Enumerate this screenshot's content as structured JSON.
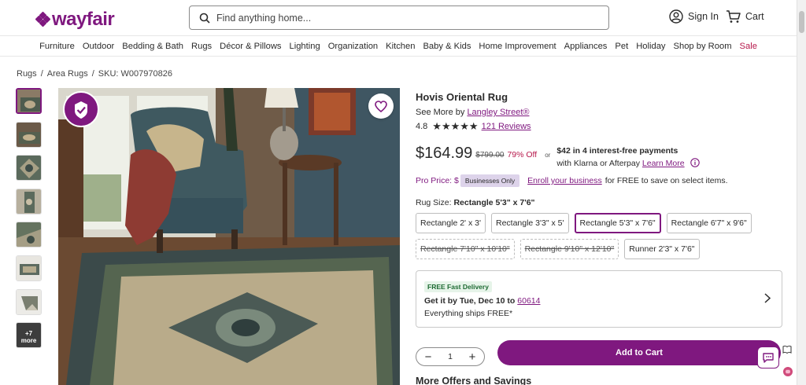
{
  "header": {
    "logo_text": "wayfair",
    "search_placeholder": "Find anything home...",
    "signin_label": "Sign In",
    "cart_label": "Cart"
  },
  "nav": {
    "items": [
      "Furniture",
      "Outdoor",
      "Bedding & Bath",
      "Rugs",
      "Décor & Pillows",
      "Lighting",
      "Organization",
      "Kitchen",
      "Baby & Kids",
      "Home Improvement",
      "Appliances",
      "Pet",
      "Holiday",
      "Shop by Room",
      "Sale"
    ]
  },
  "breadcrumb": {
    "items": [
      "Rugs",
      "Area Rugs",
      "SKU: W007970826"
    ],
    "separator": "/"
  },
  "gallery": {
    "more_label": "+7",
    "more_sub": "more",
    "verified_text": "WAYFAIR VERIFIED"
  },
  "product": {
    "title": "Hovis Oriental Rug",
    "see_more_prefix": "See More by",
    "brand": "Langley Street®",
    "rating": "4.8",
    "stars": "★★★★★",
    "reviews": "121 Reviews",
    "price": "$164.99",
    "was_price": "$799.00",
    "percent_off": "79% Off",
    "or": "or",
    "installments": "$42 in 4 interest-free payments",
    "installments_sub": "with Klarna or Afterpay",
    "learn_more": "Learn More",
    "pro_price_label": "Pro Price: $",
    "pro_badge": "Businesses Only",
    "enroll_link": "Enroll your business",
    "enroll_rest": "for FREE to save on select items.",
    "size_label_prefix": "Rug Size:",
    "size_selected": "Rectangle 5'3\" x 7'6\"",
    "sizes": [
      {
        "label": "Rectangle 2' x 3'",
        "state": "available"
      },
      {
        "label": "Rectangle 3'3\" x 5'",
        "state": "available"
      },
      {
        "label": "Rectangle 5'3\" x 7'6\"",
        "state": "selected"
      },
      {
        "label": "Rectangle 6'7\" x 9'6\"",
        "state": "available"
      },
      {
        "label": "Rectangle 7'10\" x 10'10\"",
        "state": "unavailable"
      },
      {
        "label": "Rectangle 9'10\" x 12'10\"",
        "state": "unavailable"
      },
      {
        "label": "Runner 2'3\" x 7'6\"",
        "state": "available"
      }
    ]
  },
  "delivery": {
    "badge": "FREE Fast Delivery",
    "get_it_prefix": "Get it by Tue, Dec 10 to",
    "zip": "60614",
    "ships": "Everything ships FREE*"
  },
  "purchase": {
    "quantity": "1",
    "minus": "−",
    "plus": "+",
    "add_to_cart": "Add to Cart"
  },
  "more_offers": "More Offers and Savings",
  "colors": {
    "brand": "#7f187f",
    "sale": "#b7194c"
  }
}
